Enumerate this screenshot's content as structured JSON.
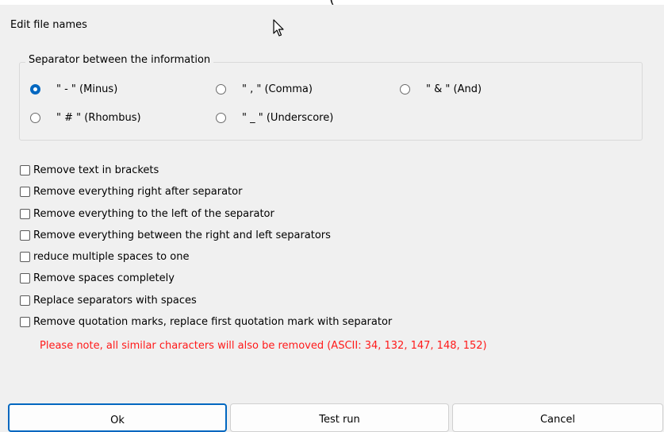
{
  "window": {
    "top_clip_text": "(",
    "title": "Edit file names"
  },
  "separator_group": {
    "legend": "Separator between the information",
    "options": [
      {
        "label": "\" - \"  (Minus)",
        "checked": true
      },
      {
        "label": "\" , \"  (Comma)",
        "checked": false
      },
      {
        "label": "\" & \"  (And)",
        "checked": false
      },
      {
        "label": "\" # \"  (Rhombus)",
        "checked": false
      },
      {
        "label": "\" _ \"  (Underscore)",
        "checked": false
      }
    ]
  },
  "options": [
    {
      "label": "Remove text in brackets",
      "checked": false
    },
    {
      "label": "Remove everything right after separator",
      "checked": false
    },
    {
      "label": "Remove everything to the left of the separator",
      "checked": false
    },
    {
      "label": "Remove everything between the right and left separators",
      "checked": false
    },
    {
      "label": "reduce multiple spaces to one",
      "checked": false
    },
    {
      "label": "Remove spaces completely",
      "checked": false
    },
    {
      "label": "Replace separators with spaces",
      "checked": false
    },
    {
      "label": "Remove quotation marks, replace first quotation mark with separator",
      "checked": false
    }
  ],
  "note": "Please note, all similar characters will also be removed (ASCII: 34, 132, 147, 148, 152)",
  "buttons": {
    "ok": "Ok",
    "test_run": "Test run",
    "cancel": "Cancel"
  },
  "colors": {
    "accent": "#0067c0",
    "warning": "#ff1a1a"
  }
}
